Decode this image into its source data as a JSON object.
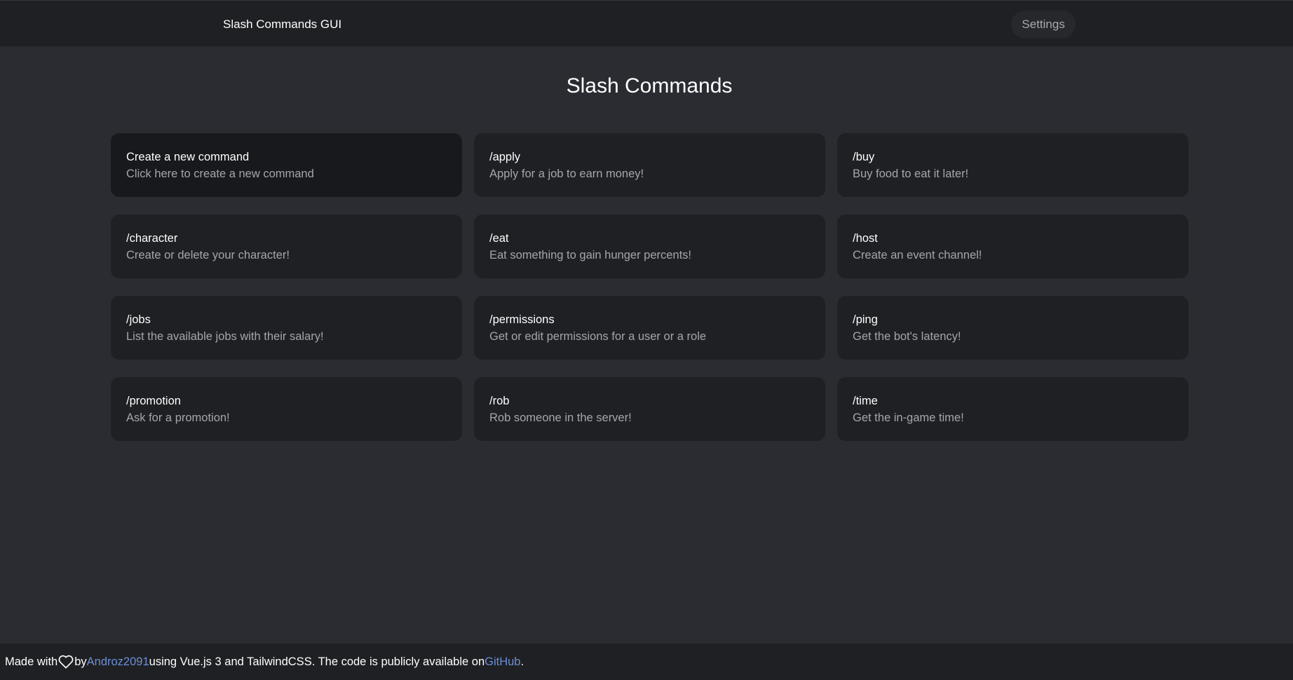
{
  "header": {
    "app_title": "Slash Commands GUI",
    "settings_label": "Settings"
  },
  "main": {
    "title": "Slash Commands",
    "create_card": {
      "name": "Create a new command",
      "description": "Click here to create a new command"
    },
    "commands": [
      {
        "name": "/apply",
        "description": "Apply for a job to earn money!"
      },
      {
        "name": "/buy",
        "description": "Buy food to eat it later!"
      },
      {
        "name": "/character",
        "description": "Create or delete your character!"
      },
      {
        "name": "/eat",
        "description": "Eat something to gain hunger percents!"
      },
      {
        "name": "/host",
        "description": "Create an event channel!"
      },
      {
        "name": "/jobs",
        "description": "List the available jobs with their salary!"
      },
      {
        "name": "/permissions",
        "description": "Get or edit permissions for a user or a role"
      },
      {
        "name": "/ping",
        "description": "Get the bot's latency!"
      },
      {
        "name": "/promotion",
        "description": "Ask for a promotion!"
      },
      {
        "name": "/rob",
        "description": "Rob someone in the server!"
      },
      {
        "name": "/time",
        "description": "Get the in-game time!"
      }
    ]
  },
  "footer": {
    "text_before_heart": "Made with",
    "heart_icon": "heart-icon",
    "text_by": "by",
    "author_link": "Androz2091",
    "text_middle": "using Vue.js 3 and TailwindCSS. The code is publicly available on",
    "github_link": "GitHub",
    "text_end": "."
  },
  "colors": {
    "background": "#2b2c31",
    "bar": "#1f2023",
    "card": "#1f2024",
    "create_card": "#18191c",
    "muted_text": "#a4a6ab",
    "link": "#6c8fd8"
  }
}
